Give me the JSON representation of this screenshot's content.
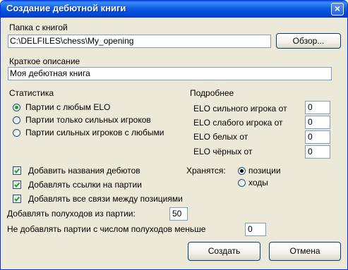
{
  "window": {
    "title": "Создание дебютной книги"
  },
  "folder": {
    "label": "Папка с книгой",
    "value": "C:\\DELFILES\\chess\\My_opening",
    "browse_label": "Обзор..."
  },
  "description": {
    "label": "Краткое описание",
    "value": "Моя дебютная книга"
  },
  "stats": {
    "label": "Статистика",
    "options": [
      "Партии с любым ELO",
      "Партии только сильных игроков",
      "Партии сильных игроков с любыми"
    ],
    "selected": 0
  },
  "details": {
    "label": "Подробнее",
    "rows": [
      {
        "label": "ELO сильного игрока от",
        "value": "0"
      },
      {
        "label": "ELO слабого игрока от",
        "value": "0"
      },
      {
        "label": "ELO белых от",
        "value": "0"
      },
      {
        "label": "ELO чёрных от",
        "value": "0"
      }
    ]
  },
  "checks": [
    {
      "label": "Добавить названия дебютов",
      "checked": true
    },
    {
      "label": "Добавлять ссылки на партии",
      "checked": true
    },
    {
      "label": "Добавлять все связи между позициями",
      "checked": true
    }
  ],
  "store": {
    "label": "Хранятся:",
    "options": [
      "позиции",
      "ходы"
    ],
    "selected": 0
  },
  "halfmoves": {
    "label": "Добавлять полуходов из партии:",
    "value": "50"
  },
  "min_halfmoves": {
    "label": "Не добавлять партии с числом полуходов меньше",
    "value": "0"
  },
  "buttons": {
    "create": "Создать",
    "cancel": "Отмена"
  }
}
